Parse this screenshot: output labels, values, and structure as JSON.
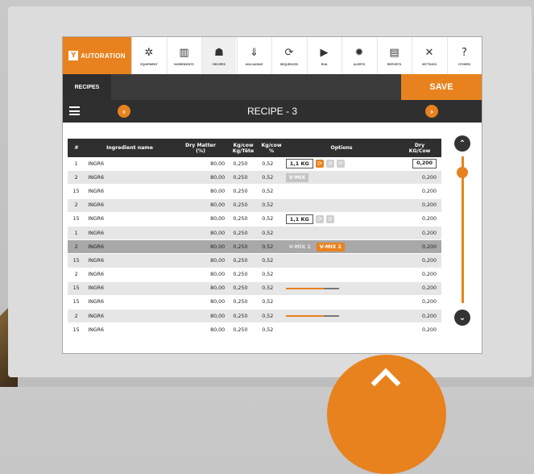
{
  "app": {
    "logo_mark": "Y",
    "logo_text": "AUTORATION"
  },
  "nav": [
    {
      "label": "EQUIPMENT",
      "icon": "gear-icon",
      "glyph": "✲"
    },
    {
      "label": "INGREDIENTS",
      "icon": "silos-icon",
      "glyph": "▥"
    },
    {
      "label": "RECIPES",
      "icon": "cooking-pot-icon",
      "glyph": "☗"
    },
    {
      "label": "UNLOADING",
      "icon": "unloading-icon",
      "glyph": "⇓"
    },
    {
      "label": "SEQUENCES",
      "icon": "refresh-icon",
      "glyph": "⟳"
    },
    {
      "label": "RUN",
      "icon": "play-icon",
      "glyph": "▶"
    },
    {
      "label": "ALERTS",
      "icon": "alert-icon",
      "glyph": "✹"
    },
    {
      "label": "REPORTS",
      "icon": "report-icon",
      "glyph": "▤"
    },
    {
      "label": "SETTINGS",
      "icon": "tools-icon",
      "glyph": "✕"
    },
    {
      "label": "OTHERS",
      "icon": "question-icon",
      "glyph": "?"
    }
  ],
  "subbar": {
    "tab": "RECIPES",
    "save": "SAVE"
  },
  "titlebar": {
    "title": "RECIPE - 3",
    "prev": "‹",
    "next": "›"
  },
  "table": {
    "headers": {
      "num": "#",
      "name": "Ingredient name",
      "dry1": "Dry Matter",
      "dry2": "(%)",
      "kg1": "Kg/cow",
      "kg2": "Kg/Tête",
      "pct1": "Kg/cow",
      "pct2": "%",
      "options": "Options",
      "dkg1": "Dry",
      "dkg2": "KG/Cow"
    },
    "rows": [
      {
        "num": "1",
        "name": "INGR6",
        "dry": "80,00",
        "kg": "0,250",
        "pct": "0,52",
        "dkg": "0,200",
        "opt": "kgicons",
        "kg_value": "1,1 KG",
        "icons_on": [
          true,
          false,
          false
        ],
        "dkg_boxed": true
      },
      {
        "num": "2",
        "name": "INGR6",
        "dry": "80,00",
        "kg": "0,250",
        "pct": "0,52",
        "dkg": "0,200",
        "opt": "vmix1",
        "v1": "V-MIX"
      },
      {
        "num": "15",
        "name": "INGR6",
        "dry": "80,00",
        "kg": "0,250",
        "pct": "0,52",
        "dkg": "0,200"
      },
      {
        "num": "2",
        "name": "INGR6",
        "dry": "80,00",
        "kg": "0,250",
        "pct": "0,52",
        "dkg": "0,200"
      },
      {
        "num": "15",
        "name": "INGR6",
        "dry": "80,00",
        "kg": "0,250",
        "pct": "0,52",
        "dkg": "0,200",
        "opt": "kgicons",
        "kg_value": "1,1 KG",
        "icons_on": [
          false,
          false
        ]
      },
      {
        "num": "1",
        "name": "INGR6",
        "dry": "80,00",
        "kg": "0,250",
        "pct": "0,52",
        "dkg": "0,200"
      },
      {
        "num": "2",
        "name": "INGR6",
        "dry": "80,00",
        "kg": "0,250",
        "pct": "0,52",
        "dkg": "0,200",
        "opt": "vmix2",
        "v1": "V-MIX 1",
        "v2": "V-MIX 2",
        "selected": true
      },
      {
        "num": "15",
        "name": "INGR6",
        "dry": "80,00",
        "kg": "0,250",
        "pct": "0,52",
        "dkg": "0,200"
      },
      {
        "num": "2",
        "name": "INGR6",
        "dry": "80,00",
        "kg": "0,250",
        "pct": "0,52",
        "dkg": "0,200"
      },
      {
        "num": "15",
        "name": "INGR6",
        "dry": "80,00",
        "kg": "0,250",
        "pct": "0,52",
        "dkg": "0,200",
        "opt": "progress",
        "progress": 0.72
      },
      {
        "num": "15",
        "name": "INGR6",
        "dry": "80,00",
        "kg": "0,250",
        "pct": "0,52",
        "dkg": "0,200"
      },
      {
        "num": "2",
        "name": "INGR6",
        "dry": "80,00",
        "kg": "0,250",
        "pct": "0,52",
        "dkg": "0,200",
        "opt": "progress",
        "progress": 0.72
      },
      {
        "num": "15",
        "name": "INGR6",
        "dry": "80,00",
        "kg": "0,250",
        "pct": "0,52",
        "dkg": "0,200"
      }
    ]
  },
  "scroll": {
    "up": "⌃",
    "down": "⌄",
    "position": 0.08
  },
  "colors": {
    "accent": "#e8821e",
    "dark": "#2f2f2f"
  }
}
